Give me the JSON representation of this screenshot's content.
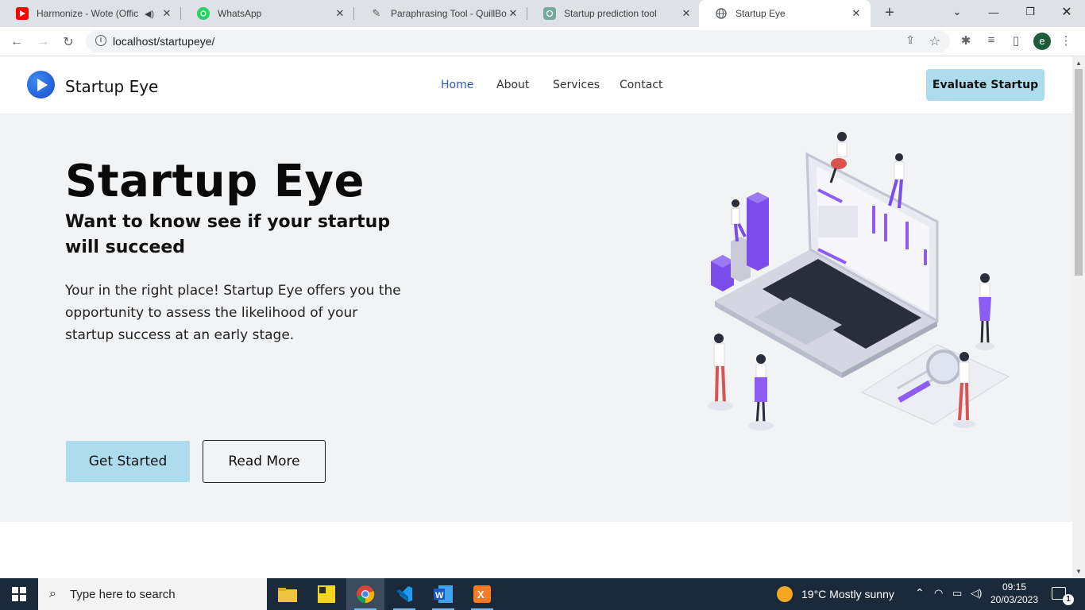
{
  "browser": {
    "tabs": [
      {
        "title": "Harmonize - Wote (Offic",
        "active": false
      },
      {
        "title": "WhatsApp",
        "active": false
      },
      {
        "title": "Paraphrasing Tool - QuillBot A",
        "active": false
      },
      {
        "title": "Startup prediction tool",
        "active": false
      },
      {
        "title": "Startup Eye",
        "active": true
      }
    ],
    "url": "localhost/startupeye/",
    "profile_initial": "e"
  },
  "site": {
    "brand": "Startup Eye",
    "nav": [
      "Home",
      "About",
      "Services",
      "Contact"
    ],
    "cta": "Evaluate Startup"
  },
  "hero": {
    "title": "Startup Eye",
    "subtitle": "Want to know see if your startup will succeed",
    "lead": "Your in the right place! Startup Eye offers you the opportunity to assess the likelihood of your startup success at an early stage.",
    "primary_button": "Get Started",
    "secondary_button": "Read More"
  },
  "taskbar": {
    "search_placeholder": "Type here to search",
    "weather": "19°C  Mostly sunny",
    "time": "09:15",
    "date": "20/03/2023",
    "notifications": "1"
  },
  "colors": {
    "accent": "#aedcef",
    "nav_active": "#2a5ec0",
    "hero_bg": "#f2f3f5",
    "purple": "#7c4dea"
  }
}
